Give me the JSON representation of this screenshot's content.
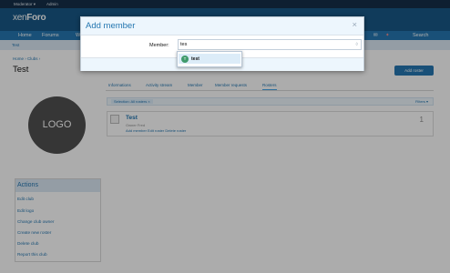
{
  "topbar": {
    "moderator": "Moderator ▾",
    "admin": "Admin"
  },
  "header": {
    "logo_a": "xen",
    "logo_b": "Foro"
  },
  "nav": {
    "home": "Home",
    "forums": "Forums",
    "partial": "W",
    "alerts": "✉",
    "search": "Search"
  },
  "subnav": {
    "item": "Test"
  },
  "breadcrumb": "Home ›  Clubs ›",
  "page_title": "Test",
  "add_roster": "Add roster",
  "club_logo": "LOGO",
  "tabs": [
    "Informations",
    "Activity stream",
    "Member",
    "Member requests",
    "Rosters"
  ],
  "filter": {
    "selection": "Selection: All rosters ×",
    "filters": "Filters ▾"
  },
  "roster": {
    "name": "Test",
    "owner": "Owner Fred",
    "links": "Add member Edit roster Delete roster",
    "count": "1"
  },
  "actions": {
    "heading": "Actions",
    "items": [
      "Edit club",
      "Edit logo",
      "Change club owner",
      "Create new roster",
      "Delete club",
      "Report this club"
    ]
  },
  "modal": {
    "title": "Add member",
    "close": "×",
    "member_label": "Member:",
    "member_value": "tes"
  },
  "suggestion": {
    "avatar_letter": "T",
    "name": "test"
  },
  "colors": {
    "header": "#185886",
    "nav": "#2577b1",
    "accent": "#47a7eb"
  }
}
